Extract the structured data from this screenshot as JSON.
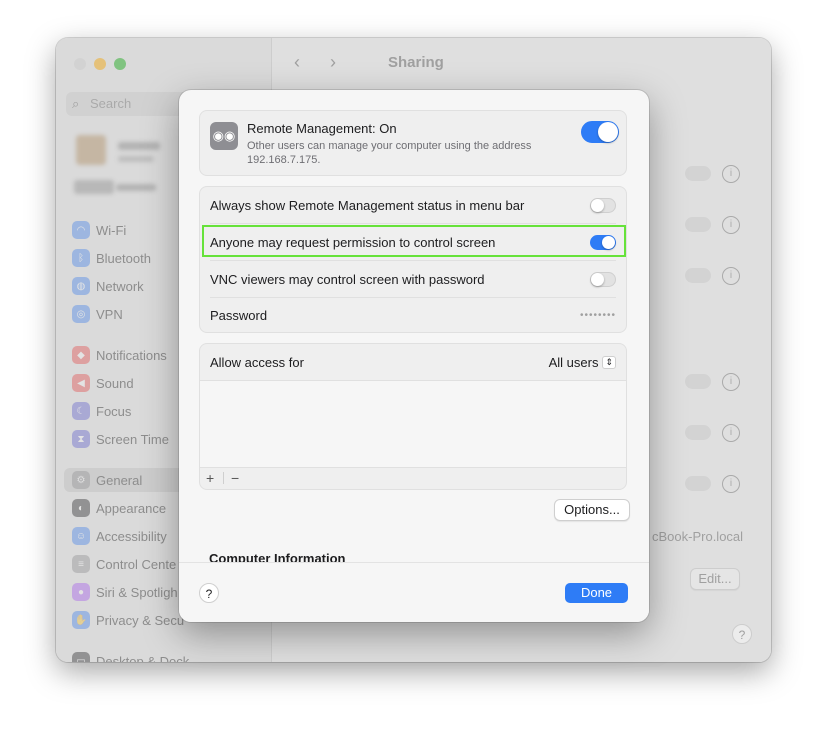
{
  "window": {
    "title": "Sharing",
    "traffic_lights": [
      "#d8d8d8",
      "#f5be4f",
      "#5ac05a"
    ]
  },
  "sidebar": {
    "search_placeholder": "Search",
    "items": [
      {
        "label": "Wi-Fi",
        "icon": "wifi-icon",
        "color": "#3b82f6",
        "glyph": "◠"
      },
      {
        "label": "Bluetooth",
        "icon": "bluetooth-icon",
        "color": "#3b82f6",
        "glyph": "ᛒ"
      },
      {
        "label": "Network",
        "icon": "globe-icon",
        "color": "#3b82f6",
        "glyph": "◍"
      },
      {
        "label": "VPN",
        "icon": "vpn-icon",
        "color": "#3b82f6",
        "glyph": "◎"
      },
      {
        "label": "Notifications",
        "icon": "bell-icon",
        "color": "#ef4444",
        "glyph": "◆"
      },
      {
        "label": "Sound",
        "icon": "speaker-icon",
        "color": "#ef4444",
        "glyph": "◀"
      },
      {
        "label": "Focus",
        "icon": "moon-icon",
        "color": "#5b5bd6",
        "glyph": "☾"
      },
      {
        "label": "Screen Time",
        "icon": "hourglass-icon",
        "color": "#5b5bd6",
        "glyph": "⧗"
      },
      {
        "label": "General",
        "icon": "gear-icon",
        "color": "#8e8e93",
        "glyph": "⚙"
      },
      {
        "label": "Appearance",
        "icon": "appearance-icon",
        "color": "#1d1d1f",
        "glyph": "◐"
      },
      {
        "label": "Accessibility",
        "icon": "accessibility-icon",
        "color": "#3b82f6",
        "glyph": "☺"
      },
      {
        "label": "Control Cente",
        "icon": "control-center-icon",
        "color": "#8e8e93",
        "glyph": "≡"
      },
      {
        "label": "Siri & Spotligh",
        "icon": "siri-icon",
        "color": "#a855f7",
        "glyph": "●"
      },
      {
        "label": "Privacy & Secu",
        "icon": "hand-icon",
        "color": "#3b82f6",
        "glyph": "✋"
      },
      {
        "label": "Desktop & Dock",
        "icon": "dock-icon",
        "color": "#1d1d1f",
        "glyph": "▭"
      }
    ]
  },
  "background": {
    "hostname_partial": "cBook-Pro.local",
    "edit_label": "Edit..."
  },
  "modal": {
    "header": {
      "title": "Remote Management: On",
      "description": "Other users can manage your computer using the address 192.168.7.175.",
      "toggle_on": true
    },
    "settings": [
      {
        "label": "Always show Remote Management status in menu bar",
        "on": false
      },
      {
        "label": "Anyone may request permission to control screen",
        "on": true
      },
      {
        "label": "VNC viewers may control screen with password",
        "on": false
      }
    ],
    "password": {
      "label": "Password",
      "value": "••••••••"
    },
    "access": {
      "label": "Allow access for",
      "value": "All users",
      "add": "+",
      "remove": "−"
    },
    "options_label": "Options...",
    "section_heading": "Computer Information",
    "help_label": "?",
    "done_label": "Done"
  }
}
